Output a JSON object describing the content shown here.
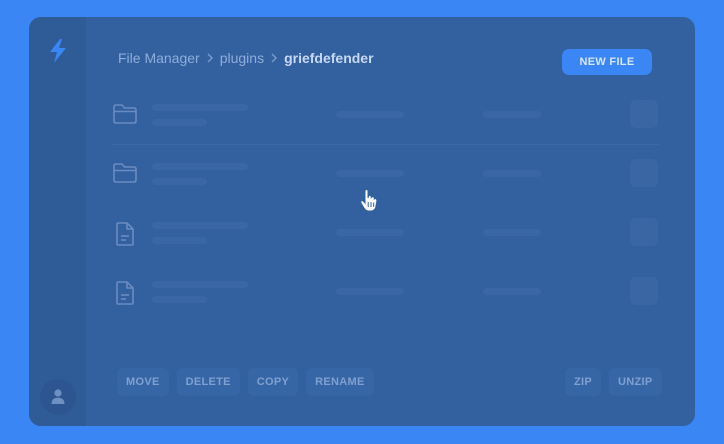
{
  "breadcrumb": {
    "items": [
      "File Manager",
      "plugins"
    ],
    "current": "griefdefender"
  },
  "header": {
    "new_file_label": "NEW FILE"
  },
  "file_rows": [
    {
      "icon": "folder-icon"
    },
    {
      "icon": "folder-icon"
    },
    {
      "icon": "file-icon"
    },
    {
      "icon": "file-icon"
    }
  ],
  "toolbar": {
    "left": [
      "MOVE",
      "DELETE",
      "COPY",
      "RENAME"
    ],
    "right": [
      "ZIP",
      "UNZIP"
    ]
  },
  "colors": {
    "accent": "#3a86f4",
    "panel": "#33609f",
    "sidebar": "#2f5b97",
    "skeleton": "#3a66a4"
  },
  "icons": {
    "logo": "lightning-bolt-icon",
    "avatar": "user-icon",
    "cursor": "hand-pointer-icon"
  }
}
